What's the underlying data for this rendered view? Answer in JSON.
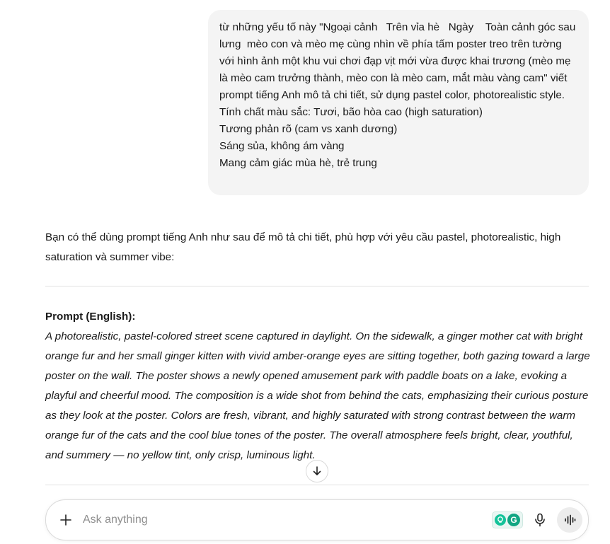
{
  "user_message": {
    "paragraph": "từ những yếu tố này \"Ngoại cảnh   Trên vỉa hè   Ngày    Toàn cảnh góc sau lưng  mèo con và mèo mẹ cùng nhìn về phía tấm poster treo trên tường với hình ảnh một khu vui chơi đạp vịt mới vừa được khai trương (mèo mẹ là mèo cam trưởng thành, mèo con là mèo cam, mắt màu vàng cam\" viết prompt tiếng Anh mô tả chi tiết, sử dụng pastel color, photorealistic style.",
    "lines": [
      "Tính chất màu sắc: Tươi, bão hòa cao (high saturation)",
      "Tương phản rõ (cam vs xanh dương)",
      "Sáng sủa, không ám vàng",
      "Mang cảm giác mùa hè, trẻ trung"
    ]
  },
  "assistant": {
    "intro": "Bạn có thể dùng prompt tiếng Anh như sau để mô tả chi tiết, phù hợp với yêu cầu pastel, photorealistic, high saturation và summer vibe:",
    "prompt_heading": "Prompt (English):",
    "prompt_body": "A photorealistic, pastel-colored street scene captured in daylight. On the sidewalk, a ginger mother cat with bright orange fur and her small ginger kitten with vivid amber-orange eyes are sitting together, both gazing toward a large poster on the wall. The poster shows a newly opened amusement park with paddle boats on a lake, evoking a playful and cheerful mood. The composition is a wide shot from behind the cats, emphasizing their curious posture as they look at the poster. Colors are fresh, vibrant, and highly saturated with strong contrast between the warm orange fur of the cats and the cool blue tones of the poster. The overall atmosphere feels bright, clear, youthful, and summery — no yellow tint, only crisp, luminous light."
  },
  "composer": {
    "placeholder": "Ask anything",
    "value": "",
    "grammarly_letter": "G"
  },
  "icons": {
    "scroll_down": "arrow-down-icon",
    "add": "plus-icon",
    "mic": "microphone-icon",
    "voice": "voice-mode-icon",
    "grammarly": "grammarly-icon"
  },
  "colors": {
    "bubble_bg": "#f4f4f4",
    "grammarly_green": "#15c39a",
    "divider": "#e3e3e3"
  }
}
